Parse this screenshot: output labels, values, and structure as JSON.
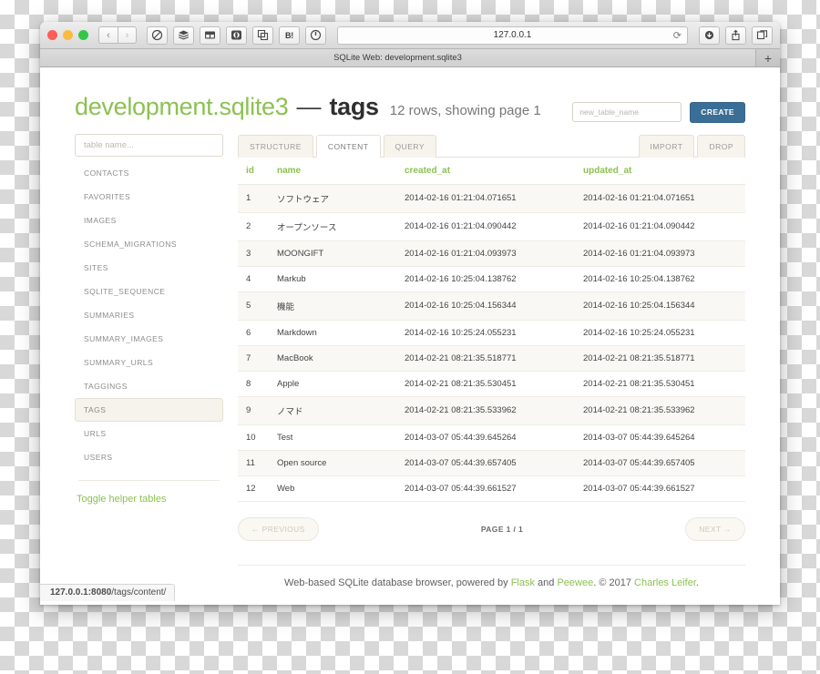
{
  "browser": {
    "url": "127.0.0.1",
    "reload_icon": "reload-icon",
    "back_icon": "chevron-left-icon",
    "forward_icon": "chevron-right-icon",
    "toolbar_icons": [
      {
        "name": "content-blocker-icon",
        "glyph": "circle-slash"
      },
      {
        "name": "layers-icon",
        "glyph": "stack"
      },
      {
        "name": "split-window-icon",
        "glyph": "split"
      },
      {
        "name": "record-icon",
        "glyph": "target"
      },
      {
        "name": "duplicate-icon",
        "glyph": "copy"
      },
      {
        "name": "hatena-bookmark-icon",
        "glyph": "B!"
      },
      {
        "name": "pocket-icon",
        "glyph": "power"
      }
    ],
    "right_icons": [
      {
        "name": "download-icon",
        "glyph": "download"
      },
      {
        "name": "share-icon",
        "glyph": "share"
      },
      {
        "name": "tab-overview-icon",
        "glyph": "tabs"
      }
    ],
    "tab_title": "SQLite Web: development.sqlite3",
    "new_tab_label": "+"
  },
  "status_bar": {
    "host": "127.0.0.1:8080",
    "path": "/tags/content/"
  },
  "header": {
    "database": "development.sqlite3",
    "dash": "—",
    "table": "tags",
    "meta": "12 rows, showing page 1",
    "new_table_placeholder": "new_table_name",
    "new_table_value": "",
    "create_label": "CREATE"
  },
  "sidebar": {
    "filter_placeholder": "table name...",
    "filter_value": "",
    "tables": [
      {
        "label": "CONTACTS",
        "active": false
      },
      {
        "label": "FAVORITES",
        "active": false
      },
      {
        "label": "IMAGES",
        "active": false
      },
      {
        "label": "SCHEMA_MIGRATIONS",
        "active": false
      },
      {
        "label": "SITES",
        "active": false
      },
      {
        "label": "SQLITE_SEQUENCE",
        "active": false
      },
      {
        "label": "SUMMARIES",
        "active": false
      },
      {
        "label": "SUMMARY_IMAGES",
        "active": false
      },
      {
        "label": "SUMMARY_URLS",
        "active": false
      },
      {
        "label": "TAGGINGS",
        "active": false
      },
      {
        "label": "TAGS",
        "active": true
      },
      {
        "label": "URLS",
        "active": false
      },
      {
        "label": "USERS",
        "active": false
      }
    ],
    "toggle_helper_label": "Toggle helper tables"
  },
  "tabs": {
    "left": [
      {
        "label": "STRUCTURE",
        "active": false
      },
      {
        "label": "CONTENT",
        "active": true
      },
      {
        "label": "QUERY",
        "active": false
      }
    ],
    "right": [
      {
        "label": "IMPORT"
      },
      {
        "label": "DROP"
      }
    ]
  },
  "table": {
    "columns": [
      "id",
      "name",
      "created_at",
      "updated_at"
    ],
    "rows": [
      [
        "1",
        "ソフトウェア",
        "2014-02-16 01:21:04.071651",
        "2014-02-16 01:21:04.071651"
      ],
      [
        "2",
        "オープンソース",
        "2014-02-16 01:21:04.090442",
        "2014-02-16 01:21:04.090442"
      ],
      [
        "3",
        "MOONGIFT",
        "2014-02-16 01:21:04.093973",
        "2014-02-16 01:21:04.093973"
      ],
      [
        "4",
        "Markub",
        "2014-02-16 10:25:04.138762",
        "2014-02-16 10:25:04.138762"
      ],
      [
        "5",
        "機能",
        "2014-02-16 10:25:04.156344",
        "2014-02-16 10:25:04.156344"
      ],
      [
        "6",
        "Markdown",
        "2014-02-16 10:25:24.055231",
        "2014-02-16 10:25:24.055231"
      ],
      [
        "7",
        "MacBook",
        "2014-02-21 08:21:35.518771",
        "2014-02-21 08:21:35.518771"
      ],
      [
        "8",
        "Apple",
        "2014-02-21 08:21:35.530451",
        "2014-02-21 08:21:35.530451"
      ],
      [
        "9",
        "ノマド",
        "2014-02-21 08:21:35.533962",
        "2014-02-21 08:21:35.533962"
      ],
      [
        "10",
        "Test",
        "2014-03-07 05:44:39.645264",
        "2014-03-07 05:44:39.645264"
      ],
      [
        "11",
        "Open source",
        "2014-03-07 05:44:39.657405",
        "2014-03-07 05:44:39.657405"
      ],
      [
        "12",
        "Web",
        "2014-03-07 05:44:39.661527",
        "2014-03-07 05:44:39.661527"
      ]
    ]
  },
  "pagination": {
    "previous_label": "← PREVIOUS",
    "page_label": "PAGE 1 / 1",
    "next_label": "NEXT →"
  },
  "footer": {
    "text_1": "Web-based SQLite database browser, powered by ",
    "link_flask": "Flask",
    "text_2": " and ",
    "link_peewee": "Peewee",
    "text_3": ". © 2017 ",
    "link_author": "Charles Leifer",
    "text_4": "."
  },
  "colors": {
    "green": "#8cc152",
    "blue": "#3b6e96",
    "row_stripe": "#faf8f4",
    "active_item": "#f6f3ec"
  }
}
